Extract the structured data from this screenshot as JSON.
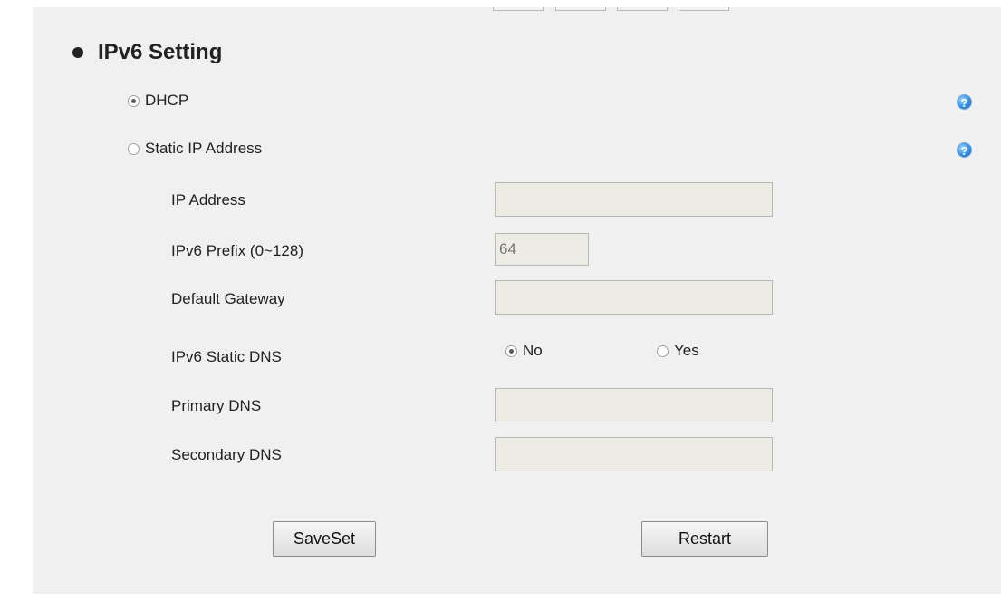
{
  "section": {
    "title": "IPv6 Setting"
  },
  "mode": {
    "dhcp_label": "DHCP",
    "static_label": "Static IP Address",
    "selected": "dhcp"
  },
  "fields": {
    "ip_address": {
      "label": "IP Address",
      "value": ""
    },
    "prefix": {
      "label": "IPv6 Prefix (0~128)",
      "value": "64"
    },
    "gateway": {
      "label": "Default Gateway",
      "value": ""
    },
    "static_dns": {
      "label": "IPv6 Static DNS",
      "no_label": "No",
      "yes_label": "Yes",
      "selected": "no"
    },
    "primary_dns": {
      "label": "Primary DNS",
      "value": ""
    },
    "secondary_dns": {
      "label": "Secondary DNS",
      "value": ""
    }
  },
  "buttons": {
    "save": "SaveSet",
    "restart": "Restart"
  },
  "help": {
    "glyph": "?",
    "icon": "help-icon",
    "color": "#2b8be0"
  }
}
